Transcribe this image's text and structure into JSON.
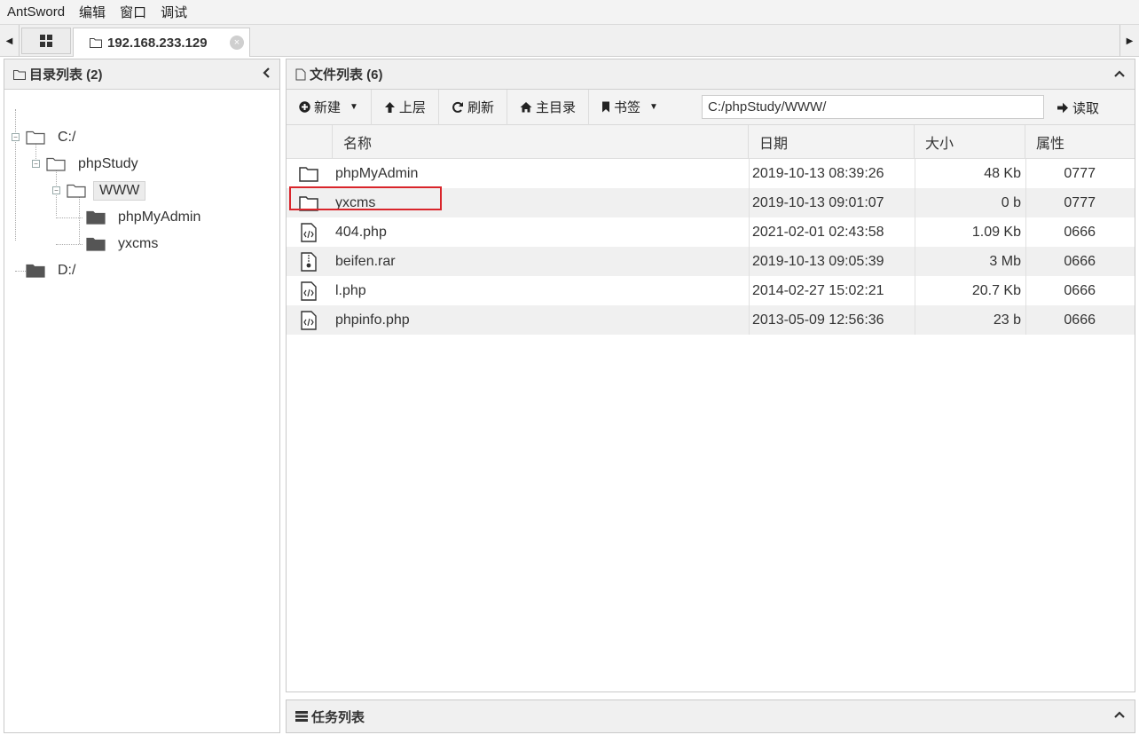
{
  "menu": [
    "AntSword",
    "编辑",
    "窗口",
    "调试"
  ],
  "tabbar": {
    "tab_label": "192.168.233.129",
    "close_glyph": "×"
  },
  "left_panel": {
    "title": "目录列表 (2)",
    "tree": [
      {
        "label": "C:/",
        "level": 0,
        "type": "folder-open"
      },
      {
        "label": "phpStudy",
        "level": 1,
        "type": "folder-open"
      },
      {
        "label": "WWW",
        "level": 2,
        "type": "folder-open",
        "selected": true
      },
      {
        "label": "phpMyAdmin",
        "level": 3,
        "type": "folder"
      },
      {
        "label": "yxcms",
        "level": 3,
        "type": "folder"
      },
      {
        "label": "D:/",
        "level": 0,
        "type": "folder"
      }
    ]
  },
  "right_panel": {
    "title": "文件列表 (6)",
    "toolbar": {
      "new_label": "新建",
      "up_label": "上层",
      "refresh_label": "刷新",
      "home_label": "主目录",
      "bookmark_label": "书签",
      "path_value": "C:/phpStudy/WWW/",
      "read_label": "读取"
    },
    "columns": {
      "name": "名称",
      "date": "日期",
      "size": "大小",
      "attr": "属性"
    },
    "files": [
      {
        "icon": "folder-icon",
        "name": "phpMyAdmin",
        "date": "2019-10-13 08:39:26",
        "size": "48 Kb",
        "attr": "0777"
      },
      {
        "icon": "folder-icon",
        "name": "yxcms",
        "date": "2019-10-13 09:01:07",
        "size": "0 b",
        "attr": "0777"
      },
      {
        "icon": "code-file-icon",
        "name": "404.php",
        "date": "2021-02-01 02:43:58",
        "size": "1.09 Kb",
        "attr": "0666"
      },
      {
        "icon": "archive-file-icon",
        "name": "beifen.rar",
        "date": "2019-10-13 09:05:39",
        "size": "3 Mb",
        "attr": "0666"
      },
      {
        "icon": "code-file-icon",
        "name": "l.php",
        "date": "2014-02-27 15:02:21",
        "size": "20.7 Kb",
        "attr": "0666"
      },
      {
        "icon": "code-file-icon",
        "name": "phpinfo.php",
        "date": "2013-05-09 12:56:36",
        "size": "23 b",
        "attr": "0666"
      }
    ]
  },
  "task_panel": {
    "title": "任务列表"
  },
  "colors": {
    "highlight": "#d9252b",
    "row_alt": "#f0f0f0",
    "header_bg": "#f0f0f0"
  }
}
